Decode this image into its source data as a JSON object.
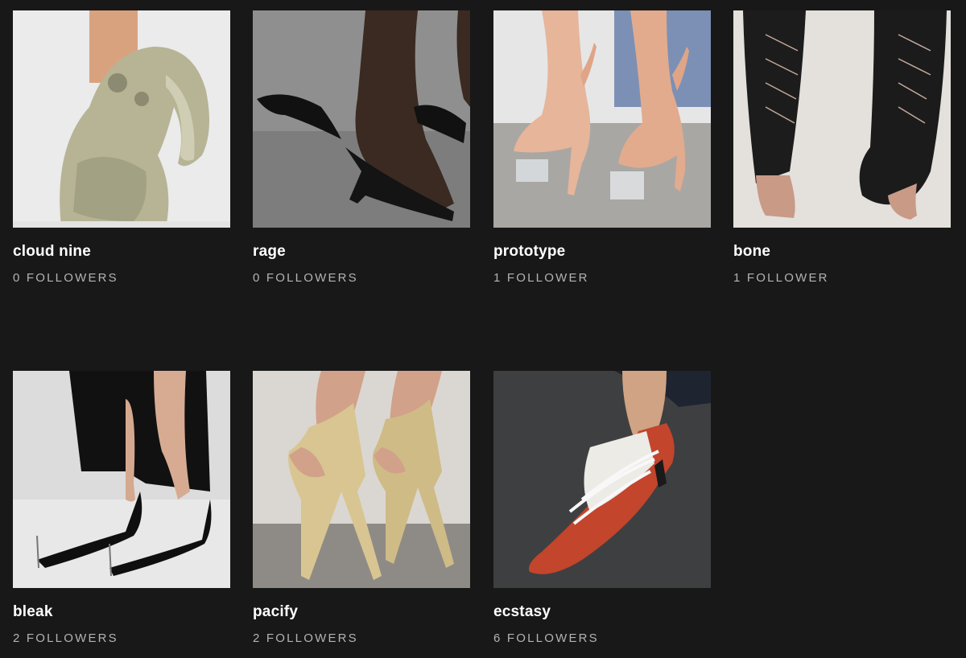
{
  "colors": {
    "background": "#181818",
    "title": "#ffffff",
    "subtitle": "#b3b3b3"
  },
  "playlists": [
    {
      "title": "cloud nine",
      "followers": "0 FOLLOWERS",
      "image": "skull-heel-photo"
    },
    {
      "title": "rage",
      "followers": "0 FOLLOWERS",
      "image": "feather-sandal-photo"
    },
    {
      "title": "prototype",
      "followers": "1 FOLLOWER",
      "image": "flesh-heel-photo"
    },
    {
      "title": "bone",
      "followers": "1 FOLLOWER",
      "image": "lace-up-boot-photo"
    },
    {
      "title": "bleak",
      "followers": "2 FOLLOWERS",
      "image": "black-pointed-pump-photo"
    },
    {
      "title": "pacify",
      "followers": "2 FOLLOWERS",
      "image": "beige-platform-photo"
    },
    {
      "title": "ecstasy",
      "followers": "6 FOLLOWERS",
      "image": "red-sneaker-heel-photo"
    }
  ]
}
